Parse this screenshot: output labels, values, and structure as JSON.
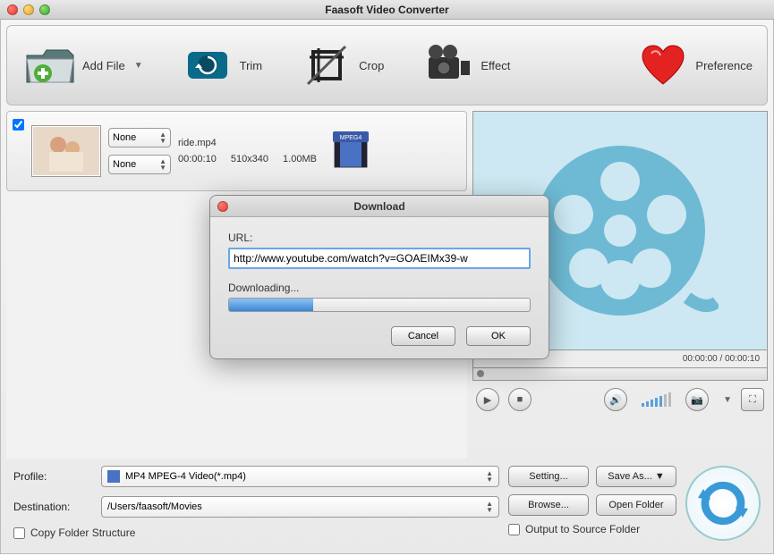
{
  "window": {
    "title": "Faasoft Video Converter"
  },
  "toolbar": {
    "add_file": "Add File",
    "trim": "Trim",
    "crop": "Crop",
    "effect": "Effect",
    "preference": "Preference"
  },
  "file": {
    "name": "ride.mp4",
    "duration": "00:00:10",
    "resolution": "510x340",
    "size": "1.00MB",
    "format_badge": "MPEG4",
    "select1": "None",
    "select2": "None"
  },
  "preview": {
    "time": "00:00:00 / 00:00:10"
  },
  "bottom": {
    "profile_label": "Profile:",
    "profile_value": "MP4 MPEG-4 Video(*.mp4)",
    "dest_label": "Destination:",
    "dest_value": "/Users/faasoft/Movies",
    "setting": "Setting...",
    "save_as": "Save As...",
    "browse": "Browse...",
    "open_folder": "Open Folder",
    "copy_structure": "Copy Folder Structure",
    "output_source": "Output to Source Folder"
  },
  "dialog": {
    "title": "Download",
    "url_label": "URL:",
    "url_value": "http://www.youtube.com/watch?v=GOAEIMx39-w",
    "status": "Downloading...",
    "progress_pct": 28,
    "cancel": "Cancel",
    "ok": "OK"
  }
}
